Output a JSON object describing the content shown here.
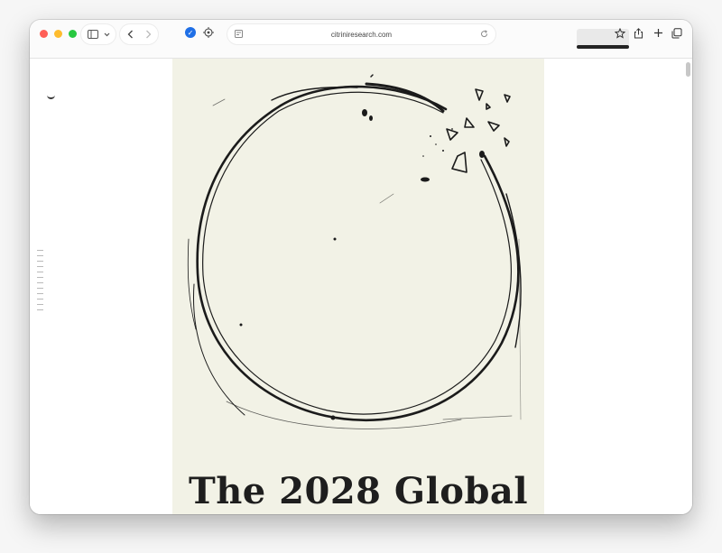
{
  "browser": {
    "address_bar": {
      "url": "citriniresearch.com"
    }
  },
  "article": {
    "cover_title": "The 2028 Global"
  },
  "colors": {
    "poster_bg": "#f2f2e6",
    "extension_blue": "#1f6fe6"
  }
}
